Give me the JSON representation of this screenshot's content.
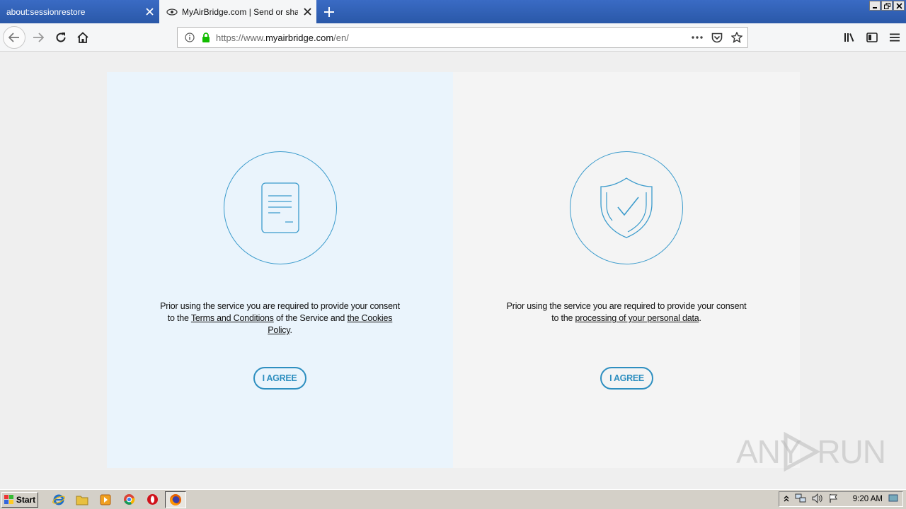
{
  "tabs": [
    {
      "title": "about:sessionrestore"
    },
    {
      "title": "MyAirBridge.com | Send or share big files"
    }
  ],
  "address_bar": {
    "url_prefix": "https://www.",
    "url_domain": "myairbridge.com",
    "url_path": "/en/"
  },
  "consent": {
    "left": {
      "text_before": "Prior using the service you are required to provide your consent to the ",
      "terms_link": "Terms and Conditions",
      "text_middle": " of the Service and ",
      "cookies_link": "the Cookies Policy",
      "text_after": ".",
      "button": "I AGREE"
    },
    "right": {
      "text_before": "Prior using the service you are required to provide your consent to the ",
      "data_link": "processing of your personal data",
      "text_after": ".",
      "button": "I AGREE"
    }
  },
  "watermark": {
    "text": "ANY  RUN"
  },
  "taskbar": {
    "start_label": "Start",
    "clock": "9:20 AM"
  },
  "colors": {
    "accent": "#2e8fc0",
    "left_panel": "#eaf4fc",
    "right_panel": "#f4f4f4",
    "tab_strip": "#2a58a8"
  }
}
